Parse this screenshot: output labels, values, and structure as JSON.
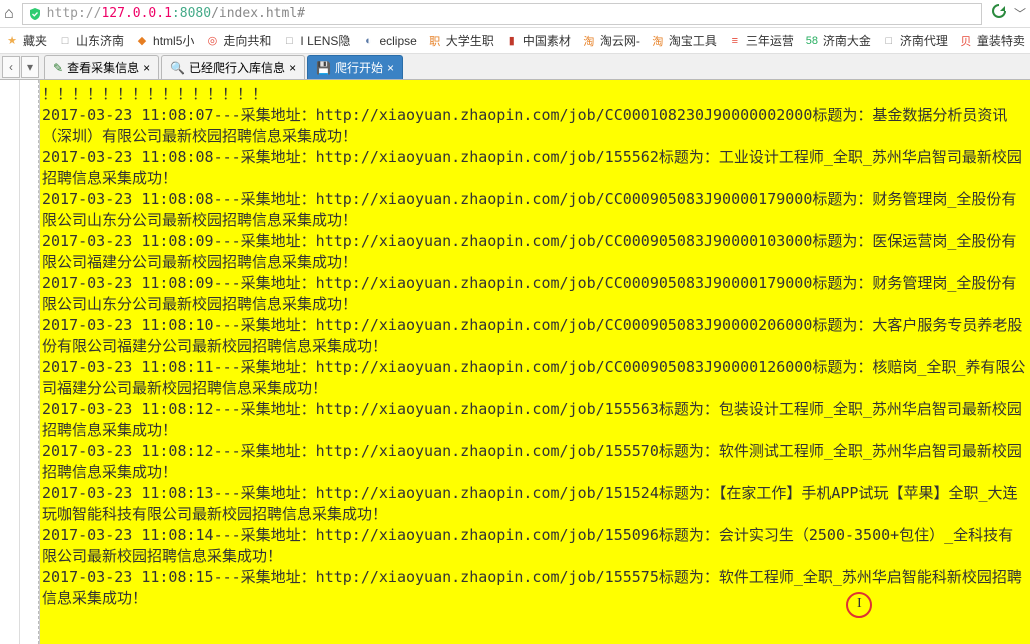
{
  "address": {
    "protocol": "http://",
    "host": "127.0.0.1",
    "port": ":8080",
    "path": "/index.html#"
  },
  "bookmarks": [
    {
      "label": "藏夹",
      "icon": "★",
      "color": "#f0ad4e"
    },
    {
      "label": "山东济南",
      "icon": "□",
      "color": "#999"
    },
    {
      "label": "html5小",
      "icon": "◆",
      "color": "#e67e22"
    },
    {
      "label": "走向共和",
      "icon": "◎",
      "color": "#e74c3c"
    },
    {
      "label": "I LENS隐",
      "icon": "□",
      "color": "#999"
    },
    {
      "label": "eclipse",
      "icon": "◐",
      "color": "#5b7aa8"
    },
    {
      "label": "大学生职",
      "icon": "职",
      "color": "#e67e22"
    },
    {
      "label": "中国素材",
      "icon": "▮",
      "color": "#c0392b"
    },
    {
      "label": "淘云网-",
      "icon": "淘",
      "color": "#e67e22"
    },
    {
      "label": "淘宝工具",
      "icon": "淘",
      "color": "#e67e22"
    },
    {
      "label": "三年运营",
      "icon": "≡",
      "color": "#e74c3c"
    },
    {
      "label": "济南大金",
      "icon": "58",
      "color": "#27ae60"
    },
    {
      "label": "济南代理",
      "icon": "□",
      "color": "#999"
    },
    {
      "label": "童装特卖",
      "icon": "贝",
      "color": "#e74c3c"
    }
  ],
  "tabs": [
    {
      "label": "查看采集信息",
      "icon": "✎",
      "iconColor": "#2e7d32",
      "active": false
    },
    {
      "label": "已经爬行入库信息",
      "icon": "🔍",
      "iconColor": "#1976d2",
      "active": false
    },
    {
      "label": "爬行开始",
      "icon": "💾",
      "iconColor": "#fff",
      "active": true
    }
  ],
  "console": {
    "header": "！！！！！！！！！！！！！！！",
    "entries": [
      "2017-03-23 11:08:07---采集地址：http://xiaoyuan.zhaopin.com/job/CC000108230J90000002000标题为：基金数据分析员资讯（深圳）有限公司最新校园招聘信息采集成功！",
      "2017-03-23 11:08:08---采集地址：http://xiaoyuan.zhaopin.com/job/155562标题为：工业设计工程师_全职_苏州华启智司最新校园招聘信息采集成功！",
      "2017-03-23 11:08:08---采集地址：http://xiaoyuan.zhaopin.com/job/CC000905083J90000179000标题为：财务管理岗_全股份有限公司山东分公司最新校园招聘信息采集成功！",
      "2017-03-23 11:08:09---采集地址：http://xiaoyuan.zhaopin.com/job/CC000905083J90000103000标题为：医保运营岗_全股份有限公司福建分公司最新校园招聘信息采集成功！",
      "2017-03-23 11:08:09---采集地址：http://xiaoyuan.zhaopin.com/job/CC000905083J90000179000标题为：财务管理岗_全股份有限公司山东分公司最新校园招聘信息采集成功！",
      "2017-03-23 11:08:10---采集地址：http://xiaoyuan.zhaopin.com/job/CC000905083J90000206000标题为：大客户服务专员养老股份有限公司福建分公司最新校园招聘信息采集成功！",
      "2017-03-23 11:08:11---采集地址：http://xiaoyuan.zhaopin.com/job/CC000905083J90000126000标题为：核赔岗_全职_养有限公司福建分公司最新校园招聘信息采集成功！",
      "2017-03-23 11:08:12---采集地址：http://xiaoyuan.zhaopin.com/job/155563标题为：包装设计工程师_全职_苏州华启智司最新校园招聘信息采集成功！",
      "2017-03-23 11:08:12---采集地址：http://xiaoyuan.zhaopin.com/job/155570标题为：软件测试工程师_全职_苏州华启智司最新校园招聘信息采集成功！",
      "2017-03-23 11:08:13---采集地址：http://xiaoyuan.zhaopin.com/job/151524标题为：【在家工作】手机APP试玩【苹果】全职_大连玩咖智能科技有限公司最新校园招聘信息采集成功！",
      "2017-03-23 11:08:14---采集地址：http://xiaoyuan.zhaopin.com/job/155096标题为：会计实习生（2500-3500+包住）_全科技有限公司最新校园招聘信息采集成功！",
      "2017-03-23 11:08:15---采集地址：http://xiaoyuan.zhaopin.com/job/155575标题为：软件工程师_全职_苏州华启智能科新校园招聘信息采集成功！"
    ]
  }
}
